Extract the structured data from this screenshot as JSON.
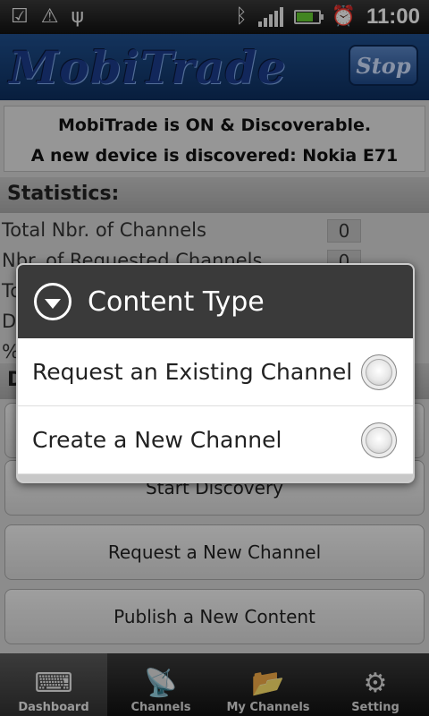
{
  "status_bar": {
    "time": "11:00",
    "icons": [
      "download-check-icon",
      "warning-icon",
      "usb-icon",
      "bluetooth-icon",
      "signal-icon",
      "battery-charging-icon",
      "alarm-icon"
    ]
  },
  "header": {
    "app_name": "MobiTrade",
    "stop_label": "Stop"
  },
  "status": {
    "line1": "MobiTrade is ON & Discoverable.",
    "line2": "A new device is discovered: Nokia E71"
  },
  "statistics": {
    "title": "Statistics:",
    "rows": [
      {
        "label": "Total Nbr. of Channels",
        "value": "0"
      },
      {
        "label": "Nbr. of Requested Channels",
        "value": "0"
      },
      {
        "label": "To",
        "value": ""
      },
      {
        "label": "D",
        "value": ""
      },
      {
        "label": "%",
        "value": ""
      }
    ]
  },
  "section2": {
    "title": "D"
  },
  "buttons": {
    "start_discovery": "Start Discovery",
    "request_channel": "Request a New Channel",
    "publish_content": "Publish a New Content"
  },
  "tabs": [
    {
      "label": "Dashboard",
      "icon": "keyboard-icon"
    },
    {
      "label": "Channels",
      "icon": "satellite-dish-icon"
    },
    {
      "label": "My Channels",
      "icon": "folder-icon"
    },
    {
      "label": "Setting",
      "icon": "settings-icon"
    }
  ],
  "dialog": {
    "title": "Content Type",
    "options": [
      {
        "label": "Request an Existing Channel",
        "selected": false
      },
      {
        "label": "Create a New Channel",
        "selected": false
      }
    ]
  }
}
